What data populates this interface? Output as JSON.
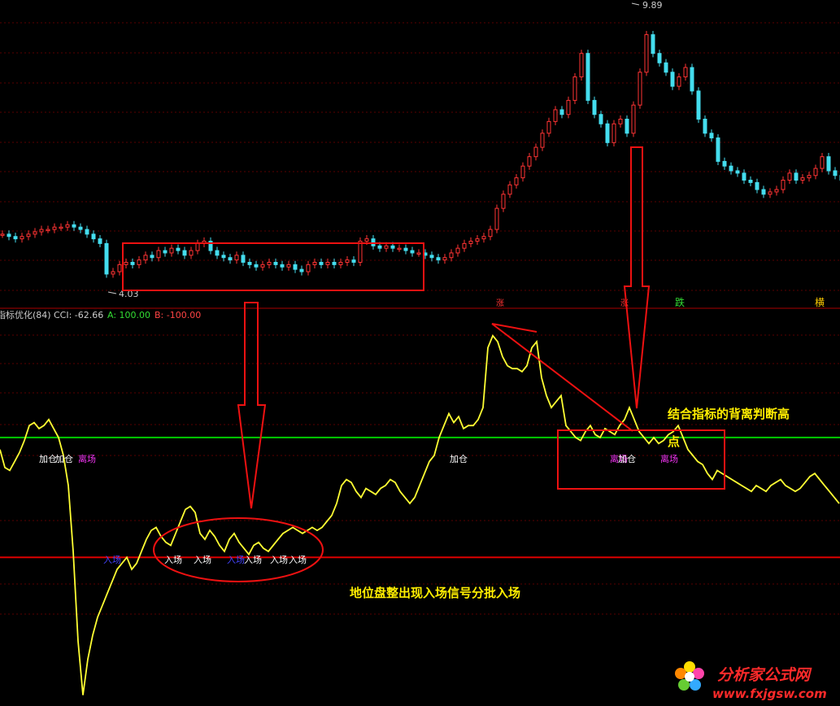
{
  "colors": {
    "background": "#000000",
    "grid": "#5a0000",
    "price_up": "#ff3333",
    "price_down": "#44ddee",
    "cci_line": "#ffff33",
    "line_a": "#00cc00",
    "line_b": "#dd0000",
    "annotation": "#ee1111",
    "note_text": "#ffee00"
  },
  "indicator_header": {
    "name": "指标优化(84)",
    "cci_label": "CCI: -62.66",
    "a_label": "A: 100.00",
    "b_label": "B: -100.00"
  },
  "chart_data": [
    {
      "type": "candlestick",
      "panel": "price",
      "high_label": "9.89",
      "low_label": "4.03",
      "ylim": [
        3.9,
        10.0
      ],
      "x": [
        0,
        8,
        16,
        24,
        32,
        40,
        48,
        56,
        64,
        72,
        80,
        88,
        96,
        104,
        112,
        120,
        128,
        136,
        144,
        152,
        160,
        168,
        176,
        184,
        192,
        200,
        208,
        216,
        224,
        232,
        240,
        248,
        256,
        264,
        272,
        280,
        288,
        296,
        304,
        312,
        320,
        328,
        336,
        344,
        352,
        360,
        368,
        376,
        384,
        392,
        400,
        408,
        416,
        424,
        432,
        440,
        448,
        456,
        464,
        472,
        480,
        488,
        496,
        504,
        512,
        520,
        528,
        536,
        544,
        552,
        560,
        568,
        576,
        584,
        592,
        600,
        608,
        616,
        624,
        632,
        640,
        648,
        656,
        664,
        672,
        680,
        688,
        696,
        704,
        712,
        720,
        728,
        736,
        744,
        752,
        760,
        768,
        776,
        784,
        792,
        800,
        808,
        816,
        824,
        832,
        840,
        848,
        856,
        864,
        872,
        880,
        888,
        896,
        904,
        912,
        920,
        928,
        936,
        944,
        952,
        960,
        968,
        976,
        984,
        992,
        1000,
        1008,
        1016,
        1024,
        1032
      ],
      "close": [
        5.15,
        5.1,
        5.05,
        5.1,
        5.15,
        5.2,
        5.25,
        5.25,
        5.3,
        5.3,
        5.35,
        5.3,
        5.25,
        5.15,
        5.05,
        4.95,
        4.3,
        4.35,
        4.5,
        4.55,
        4.5,
        4.6,
        4.7,
        4.65,
        4.8,
        4.75,
        4.85,
        4.8,
        4.7,
        4.8,
        4.95,
        5.0,
        4.8,
        4.7,
        4.65,
        4.6,
        4.7,
        4.55,
        4.5,
        4.45,
        4.5,
        4.55,
        4.5,
        4.45,
        4.5,
        4.4,
        4.35,
        4.5,
        4.55,
        4.5,
        4.55,
        4.5,
        4.55,
        4.6,
        4.55,
        5.0,
        5.05,
        4.9,
        4.85,
        4.9,
        4.85,
        4.85,
        4.8,
        4.75,
        4.75,
        4.7,
        4.65,
        4.6,
        4.65,
        4.75,
        4.85,
        4.95,
        5.0,
        5.05,
        5.1,
        5.25,
        5.7,
        6.0,
        6.2,
        6.35,
        6.6,
        6.8,
        7.0,
        7.3,
        7.55,
        7.8,
        7.7,
        8.0,
        8.5,
        9.0,
        8.0,
        7.7,
        7.5,
        7.1,
        7.5,
        7.6,
        7.3,
        7.9,
        8.6,
        9.4,
        9.0,
        8.8,
        8.6,
        8.3,
        8.5,
        8.7,
        8.2,
        7.6,
        7.3,
        7.2,
        6.7,
        6.6,
        6.5,
        6.45,
        6.3,
        6.25,
        6.1,
        6.0,
        6.05,
        6.1,
        6.3,
        6.45,
        6.3,
        6.35,
        6.4,
        6.55,
        6.8,
        6.5,
        6.4,
        6.3
      ]
    },
    {
      "type": "line",
      "panel": "indicator",
      "ylim": [
        -340,
        290
      ],
      "levels": {
        "A": 100,
        "B": -100
      },
      "x": [
        0,
        6,
        12,
        18,
        24,
        30,
        36,
        42,
        48,
        54,
        60,
        66,
        72,
        78,
        84,
        90,
        96,
        102,
        108,
        114,
        120,
        126,
        132,
        138,
        144,
        150,
        156,
        162,
        168,
        174,
        180,
        186,
        192,
        198,
        204,
        210,
        216,
        222,
        228,
        234,
        240,
        246,
        252,
        258,
        264,
        270,
        276,
        282,
        288,
        294,
        300,
        306,
        312,
        318,
        324,
        330,
        336,
        342,
        348,
        354,
        360,
        366,
        372,
        378,
        384,
        390,
        396,
        402,
        408,
        414,
        420,
        426,
        432,
        438,
        444,
        450,
        456,
        462,
        468,
        474,
        480,
        486,
        492,
        498,
        504,
        510,
        516,
        522,
        528,
        534,
        540,
        546,
        552,
        558,
        564,
        570,
        576,
        582,
        588,
        594,
        600,
        606,
        612,
        618,
        624,
        630,
        636,
        642,
        648,
        654,
        660,
        666,
        672,
        678,
        684,
        690,
        696,
        702,
        708,
        714,
        720,
        726,
        732,
        738,
        744,
        750,
        756,
        762,
        768,
        774,
        780,
        786,
        792,
        798,
        804,
        810,
        816,
        822,
        828,
        834,
        840,
        846,
        852,
        858,
        864,
        870,
        876,
        882,
        888,
        894,
        900,
        906,
        912,
        918,
        924,
        930,
        936,
        942,
        948,
        954,
        960,
        966,
        972,
        978,
        984,
        990,
        996,
        1002,
        1008,
        1014,
        1020,
        1026,
        1032
      ],
      "y": [
        80,
        50,
        45,
        60,
        75,
        95,
        120,
        125,
        115,
        120,
        130,
        115,
        100,
        70,
        20,
        -90,
        -240,
        -330,
        -270,
        -230,
        -200,
        -180,
        -160,
        -140,
        -120,
        -110,
        -100,
        -120,
        -110,
        -90,
        -70,
        -55,
        -50,
        -65,
        -75,
        -80,
        -60,
        -40,
        -20,
        -15,
        -25,
        -60,
        -70,
        -55,
        -65,
        -80,
        -90,
        -70,
        -60,
        -75,
        -85,
        -95,
        -80,
        -75,
        -85,
        -90,
        -80,
        -70,
        -60,
        -55,
        -50,
        -55,
        -60,
        -55,
        -50,
        -55,
        -50,
        -40,
        -30,
        -10,
        20,
        30,
        25,
        10,
        0,
        15,
        10,
        5,
        15,
        20,
        30,
        25,
        10,
        0,
        -10,
        0,
        20,
        40,
        60,
        70,
        100,
        120,
        140,
        125,
        135,
        115,
        120,
        120,
        130,
        150,
        250,
        270,
        260,
        235,
        220,
        215,
        215,
        210,
        220,
        250,
        260,
        200,
        170,
        150,
        160,
        170,
        120,
        110,
        100,
        95,
        110,
        120,
        105,
        100,
        115,
        110,
        105,
        120,
        130,
        150,
        130,
        110,
        100,
        90,
        100,
        90,
        95,
        105,
        110,
        120,
        100,
        80,
        70,
        60,
        55,
        40,
        30,
        45,
        40,
        35,
        30,
        25,
        20,
        15,
        10,
        20,
        15,
        10,
        20,
        25,
        30,
        20,
        15,
        10,
        15,
        25,
        35,
        40,
        30,
        20,
        10,
        0,
        -10,
        -20,
        -30,
        -40
      ]
    }
  ],
  "signals": [
    {
      "text": "加仓",
      "color": "#ffffff"
    },
    {
      "text": "加仓",
      "color": "#ffffff"
    },
    {
      "text": "离场",
      "color": "#ee33ee"
    },
    {
      "text": "离场",
      "color": "#ee33ee"
    },
    {
      "text": "入场",
      "color": "#4444ff"
    },
    {
      "text": "入场",
      "color": "#ffffff"
    },
    {
      "text": "入场",
      "color": "#ffffff"
    },
    {
      "text": "入场",
      "color": "#4444ff"
    },
    {
      "text": "入场",
      "color": "#ffffff"
    },
    {
      "text": "入场",
      "color": "#ffffff"
    },
    {
      "text": "入场",
      "color": "#ffffff"
    },
    {
      "text": "加仓",
      "color": "#ffffff"
    },
    {
      "text": "离场",
      "color": "#ee33ee"
    },
    {
      "text": "加仓",
      "color": "#ffffff"
    },
    {
      "text": "离场",
      "color": "#ee33ee"
    }
  ],
  "top_markers": [
    {
      "text": "涨",
      "color": "#ff3333"
    },
    {
      "text": "跌",
      "color": "#33dd33"
    },
    {
      "text": "横",
      "color": "#ffcc00"
    }
  ],
  "annotations": {
    "note_divergence_line1": "结合指标的背离判断高",
    "note_divergence_line2": "点",
    "note_bottom": "地位盘整出现入场信号分批入场"
  },
  "logo": {
    "name": "分析家公式网",
    "url": "www.fxjgsw.com"
  }
}
